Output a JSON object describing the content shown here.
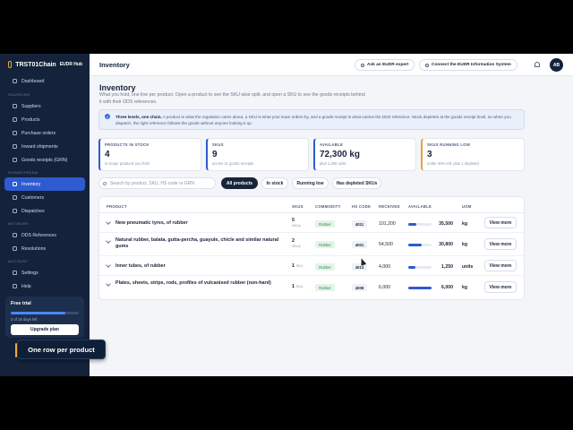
{
  "brand": {
    "name": "TRST01Chain",
    "hub": "EUDR Hub"
  },
  "sidebar": {
    "top": [
      {
        "label": "Dashboard"
      }
    ],
    "sourcing_title": "SOURCING",
    "sourcing": [
      {
        "label": "Suppliers"
      },
      {
        "label": "Products"
      },
      {
        "label": "Purchase orders"
      },
      {
        "label": "Inward shipments"
      },
      {
        "label": "Goods receipts (GRN)"
      }
    ],
    "downstream_title": "DOWNSTREAM",
    "downstream": [
      {
        "label": "Inventory",
        "active": true
      },
      {
        "label": "Customers"
      },
      {
        "label": "Dispatches"
      }
    ],
    "network_title": "NETWORK",
    "network": [
      {
        "label": "DDS References"
      },
      {
        "label": "Resolutions"
      }
    ],
    "account_title": "ACCOUNT",
    "account": [
      {
        "label": "Settings"
      },
      {
        "label": "Help"
      }
    ]
  },
  "trial": {
    "title": "Free trial",
    "progress": 0.8,
    "days": "3 of 15 days left",
    "upgrade": "Upgrade plan"
  },
  "caption": "One row per product",
  "topbar": {
    "title": "Inventory",
    "ask": "Ask an EUDR expert",
    "connect": "Connect the EUDR Information System",
    "avatar": "AB"
  },
  "page": {
    "title": "Inventory",
    "subtitle": "What you hold, one line per product. Open a product to see the SKU wise split, and open a SKU to see the goods receipts behind it with their DDS references.",
    "info_bold": "Three levels, one chain.",
    "info_text": " A product is what the regulation cares about, a SKU is what your team orders by, and a goods receipt is what carries the DDS reference. Stock depletes at the goods receipt level, so when you dispatch, the right reference follows the goods without anyone looking it up."
  },
  "stats": [
    {
      "label": "PRODUCTS IN STOCK",
      "value": "4",
      "caption": "in scope products you hold"
    },
    {
      "label": "SKUS",
      "value": "9",
      "caption": "across 11 goods receipts"
    },
    {
      "label": "AVAILABLE",
      "value": "72,300 kg",
      "caption": "plus 1,250 units"
    },
    {
      "label": "SKUS RUNNING LOW",
      "value": "3",
      "caption": "under 40% left, plus 1 depleted"
    }
  ],
  "filters": {
    "search_placeholder": "Search by product, SKU, HS code or GRN",
    "chips": [
      "All products",
      "In stock",
      "Running low",
      "Has depleted SKUs"
    ]
  },
  "table": {
    "headers": [
      "PRODUCT",
      "SKUS",
      "COMMODITY",
      "HS CODE",
      "RECEIVED",
      "AVAILABLE",
      "UOM"
    ],
    "rows": [
      {
        "name": "New pneumatic tyres, of rubber",
        "skus": "5",
        "sku_unit": "SKUs",
        "commodity": "Rubber",
        "hs": "4011",
        "received": "101,200",
        "available": "35,500",
        "fill": 0.35,
        "uom": "kg",
        "action": "View more"
      },
      {
        "name": "Natural rubber, balata, gutta-percha, guayule, chicle and similar natural gums",
        "skus": "2",
        "sku_unit": "SKUs",
        "commodity": "Rubber",
        "hs": "4001",
        "received": "54,500",
        "available": "30,800",
        "fill": 0.57,
        "uom": "kg",
        "action": "View more"
      },
      {
        "name": "Inner tubes, of rubber",
        "skus": "1",
        "sku_unit": "SKU",
        "commodity": "Rubber",
        "hs": "4013",
        "received": "4,000",
        "available": "1,250",
        "fill": 0.31,
        "uom": "units",
        "action": "View more"
      },
      {
        "name": "Plates, sheets, strips, rods, profiles of vulcanised rubber (non-hard)",
        "skus": "1",
        "sku_unit": "SKU",
        "commodity": "Rubber",
        "hs": "4008",
        "received": "6,000",
        "available": "6,000",
        "fill": 1.0,
        "uom": "kg",
        "action": "View more"
      }
    ]
  }
}
